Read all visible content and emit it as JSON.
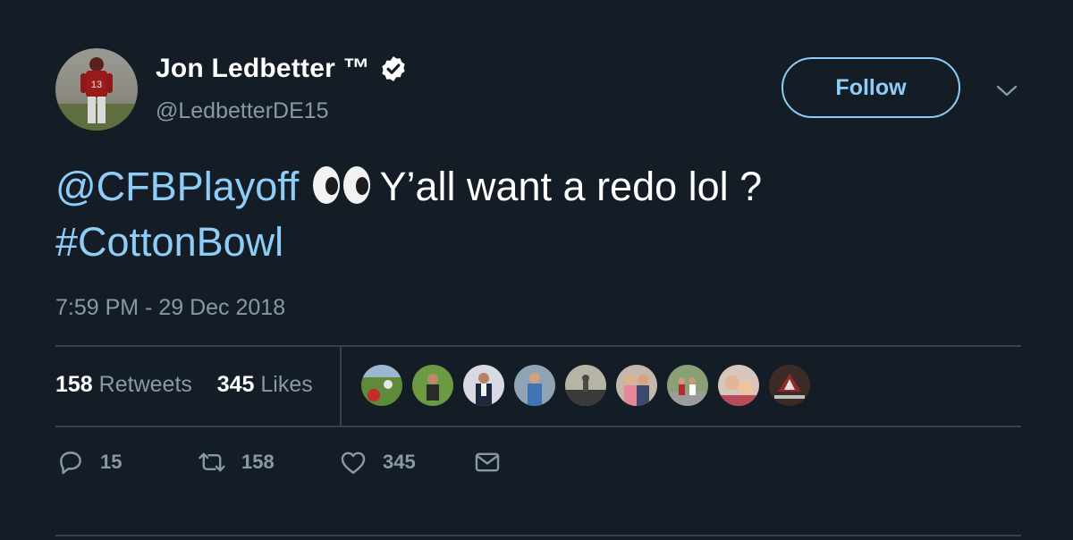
{
  "author": {
    "display_name": "Jon Ledbetter ™",
    "handle": "@LedbetterDE15",
    "jersey_number": "13"
  },
  "follow_label": "Follow",
  "tweet": {
    "mention": "@CFBPlayoff",
    "text": "Y’all want a redo lol ?",
    "hashtag": "#CottonBowl",
    "timestamp": "7:59 PM - 29 Dec 2018"
  },
  "stats": {
    "retweets_count": "158",
    "retweets_label": "Retweets",
    "likes_count": "345",
    "likes_label": "Likes"
  },
  "actions": {
    "replies": "15",
    "retweets": "158",
    "likes": "345"
  },
  "liker_avatar_count": 9,
  "colors": {
    "background": "#141d26",
    "accent": "#8ecdf8",
    "secondary_text": "#8899a6",
    "divider": "#38444d"
  }
}
